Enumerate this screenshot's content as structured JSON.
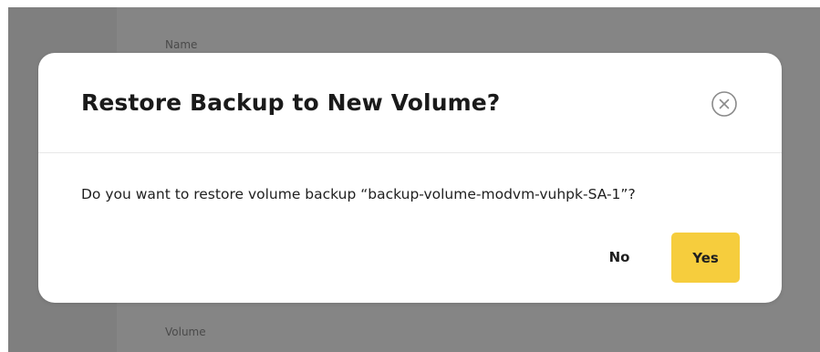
{
  "background": {
    "name_label": "Name",
    "volume_label": "Volume"
  },
  "dialog": {
    "title": "Restore Backup to New Volume?",
    "close_icon": "close-circle-icon",
    "message": "Do you want to restore volume backup “backup-volume-modvm-vuhpk-SA-1”?",
    "no_label": "No",
    "yes_label": "Yes"
  },
  "colors": {
    "overlay": "#7f7f7f",
    "primary_button": "#f6cd3d",
    "title_text": "#1a1a1a"
  }
}
